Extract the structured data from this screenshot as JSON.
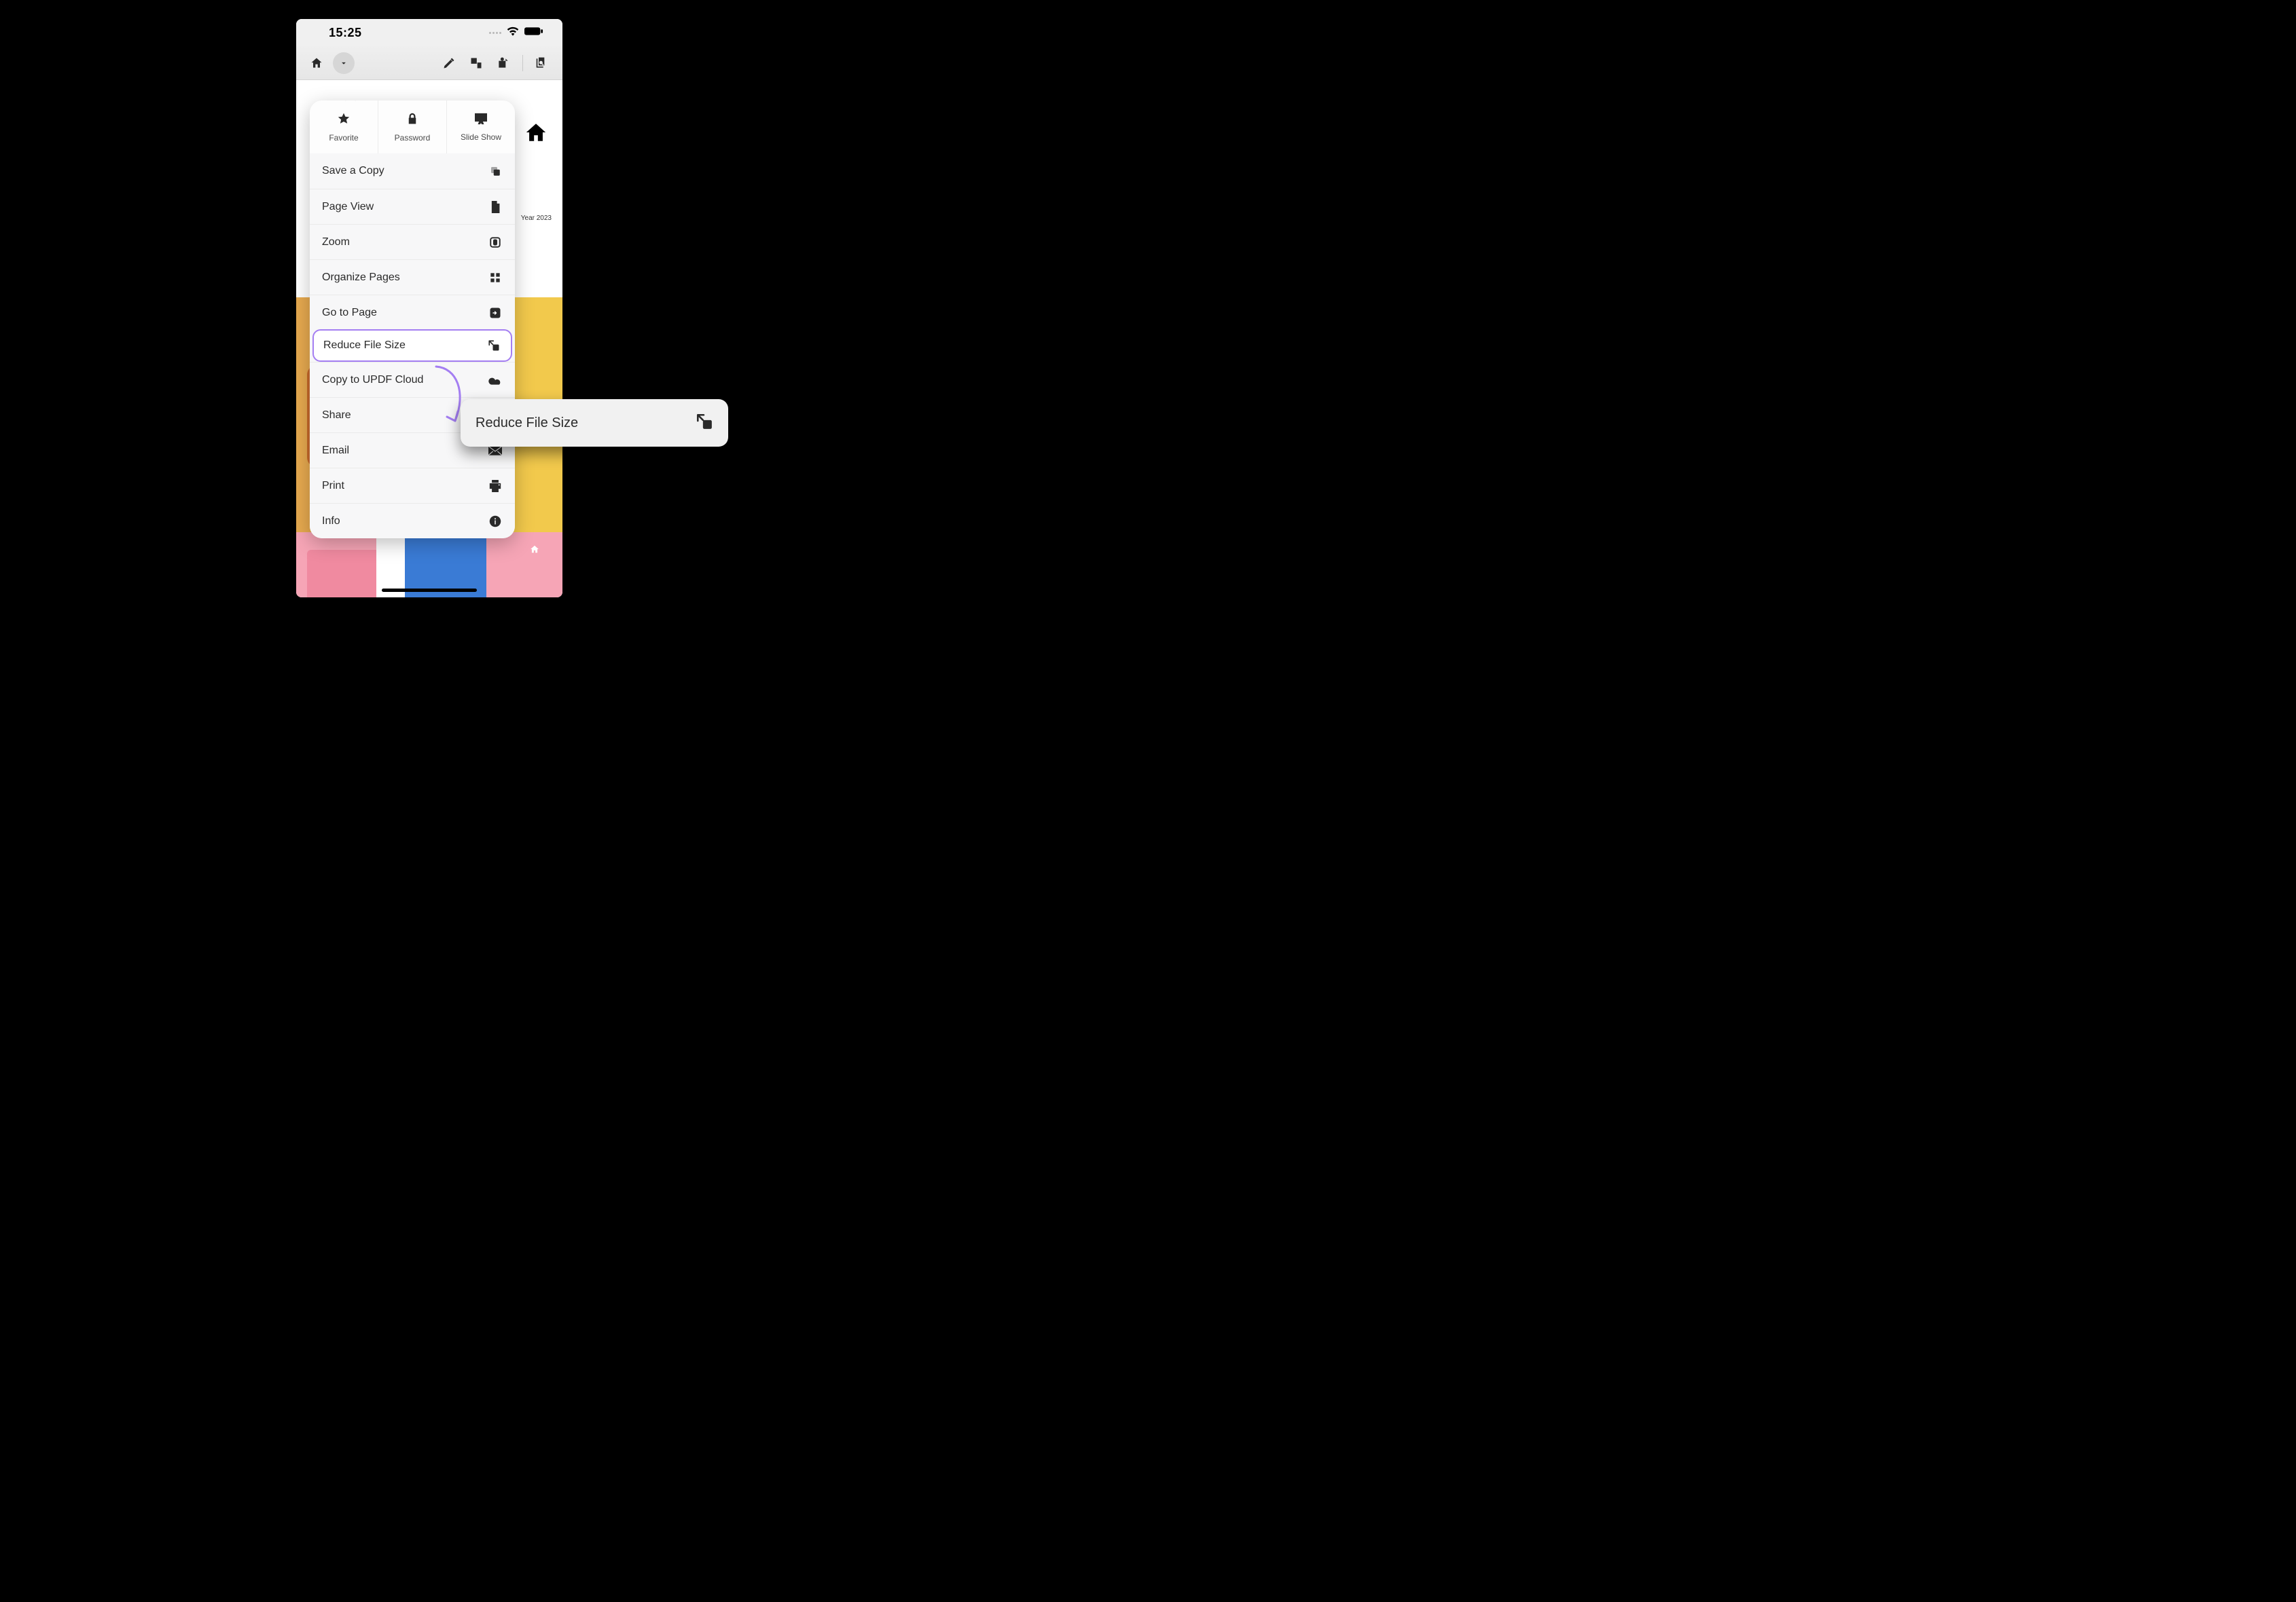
{
  "status": {
    "time": "15:25"
  },
  "document": {
    "year_label": "Year 2023"
  },
  "top_actions": {
    "favorite": "Favorite",
    "password": "Password",
    "slideshow": "Slide Show"
  },
  "menu": {
    "items": [
      {
        "label": "Save a Copy"
      },
      {
        "label": "Page View"
      },
      {
        "label": "Zoom"
      },
      {
        "label": "Organize Pages"
      },
      {
        "label": "Go to Page"
      },
      {
        "label": "Reduce File Size"
      },
      {
        "label": "Copy to UPDF Cloud"
      },
      {
        "label": "Share"
      },
      {
        "label": "Email"
      },
      {
        "label": "Print"
      },
      {
        "label": "Info"
      }
    ]
  },
  "callout": {
    "label": "Reduce File Size"
  }
}
